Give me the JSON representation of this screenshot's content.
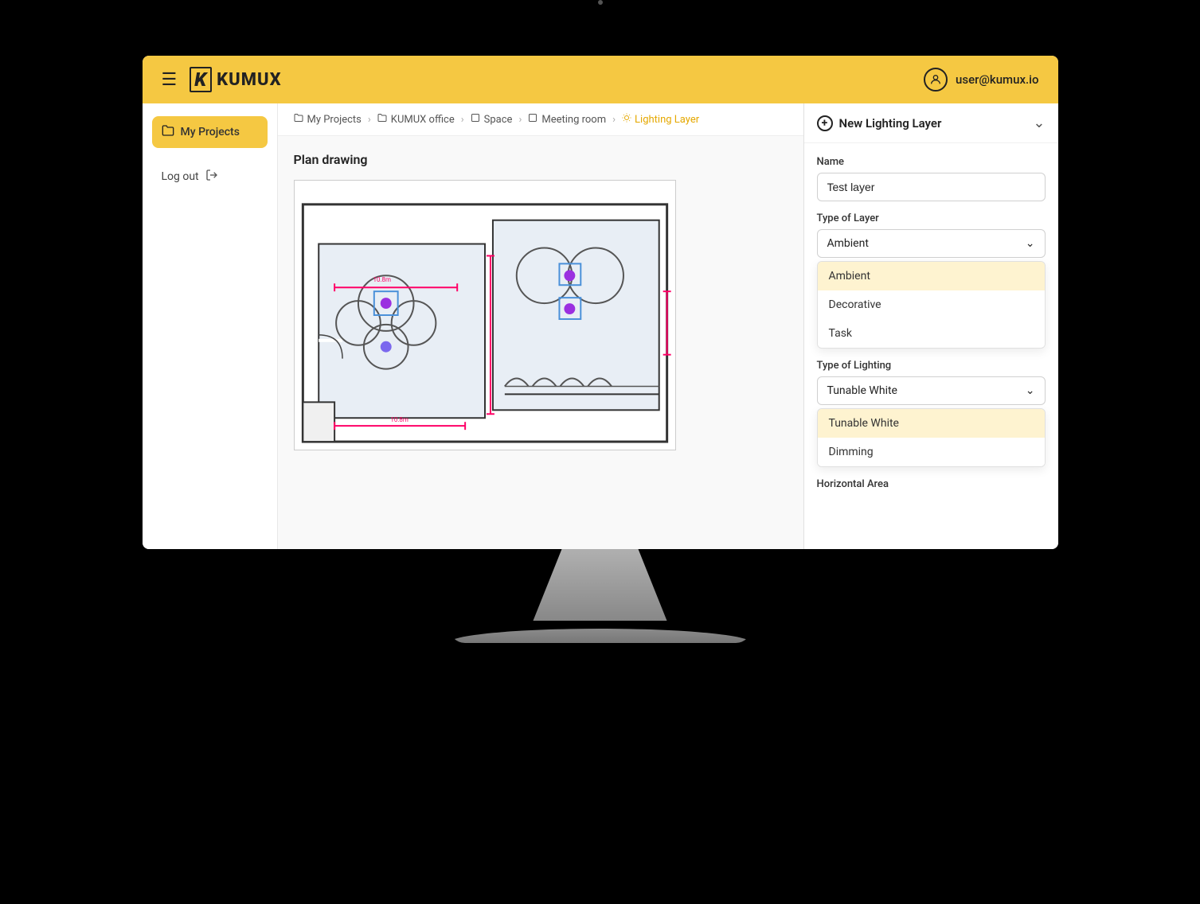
{
  "header": {
    "menu_icon": "☰",
    "logo_text": "KUMUX",
    "user_email": "user@kumux.io",
    "user_icon": "👤"
  },
  "sidebar": {
    "my_projects_label": "My Projects",
    "my_projects_icon": "🗂",
    "logout_label": "Log out",
    "logout_icon": "→"
  },
  "breadcrumb": {
    "items": [
      {
        "label": "My Projects",
        "icon": "📁"
      },
      {
        "label": "KUMUX office",
        "icon": "📁"
      },
      {
        "label": "Space",
        "icon": "🖼"
      },
      {
        "label": "Meeting room",
        "icon": "🖼"
      },
      {
        "label": "Lighting Layer",
        "icon": "💡",
        "active": true
      }
    ]
  },
  "plan": {
    "title": "Plan drawing"
  },
  "right_panel": {
    "header_title": "New Lighting Layer",
    "name_label": "Name",
    "name_value": "Test layer",
    "name_placeholder": "Test layer",
    "type_of_layer_label": "Type of Layer",
    "type_of_layer_selected": "Ambient",
    "type_of_layer_options": [
      {
        "label": "Ambient",
        "selected": true
      },
      {
        "label": "Decorative",
        "selected": false
      },
      {
        "label": "Task",
        "selected": false
      }
    ],
    "type_of_lighting_label": "Type of Lighting",
    "type_of_lighting_selected": "Tunable White",
    "type_of_lighting_options": [
      {
        "label": "Tunable White",
        "selected": true
      },
      {
        "label": "Dimming",
        "selected": false
      }
    ],
    "horizontal_area_label": "Horizontal Area"
  }
}
